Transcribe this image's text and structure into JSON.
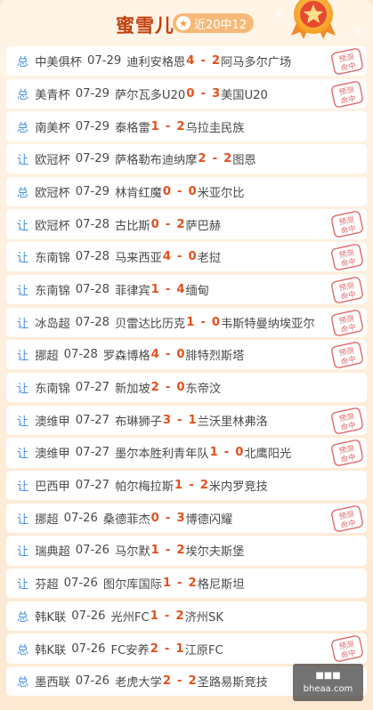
{
  "header": {
    "name": "蜜雪儿",
    "record": "近20中12"
  },
  "stamp_text": "预测命中",
  "rows": [
    {
      "type": "总",
      "league": "中美俱杯",
      "date": "07-29",
      "home": "迪利安格恩",
      "home_score": "4",
      "away_score": "2",
      "away": "阿马多尔广场",
      "hit": true
    },
    {
      "type": "总",
      "league": "美青杯",
      "date": "07-29",
      "home": "萨尔瓦多U20",
      "home_score": "0",
      "away_score": "3",
      "away": "美国U20",
      "hit": true
    },
    {
      "type": "总",
      "league": "南美杯",
      "date": "07-29",
      "home": "泰格雷",
      "home_score": "1",
      "away_score": "2",
      "away": "乌拉圭民族",
      "hit": false
    },
    {
      "type": "让",
      "league": "欧冠杯",
      "date": "07-29",
      "home": "萨格勒布迪纳摩",
      "home_score": "2",
      "away_score": "2",
      "away": "图恩",
      "hit": false
    },
    {
      "type": "总",
      "league": "欧冠杯",
      "date": "07-29",
      "home": "林肯红魔",
      "home_score": "0",
      "away_score": "0",
      "away": "米亚尔比",
      "hit": false
    },
    {
      "type": "让",
      "league": "欧冠杯",
      "date": "07-28",
      "home": "古比斯",
      "home_score": "0",
      "away_score": "2",
      "away": "萨巴赫",
      "hit": true
    },
    {
      "type": "让",
      "league": "东南锦",
      "date": "07-28",
      "home": "马来西亚",
      "home_score": "4",
      "away_score": "0",
      "away": "老挝",
      "hit": true
    },
    {
      "type": "让",
      "league": "东南锦",
      "date": "07-28",
      "home": "菲律宾",
      "home_score": "1",
      "away_score": "4",
      "away": "缅甸",
      "hit": true
    },
    {
      "type": "让",
      "league": "冰岛超",
      "date": "07-28",
      "home": "贝雷达比历克",
      "home_score": "1",
      "away_score": "0",
      "away": "韦斯特曼纳埃亚尔",
      "hit": true
    },
    {
      "type": "让",
      "league": "挪超",
      "date": "07-28",
      "home": "罗森博格",
      "home_score": "4",
      "away_score": "0",
      "away": "腓特烈斯塔",
      "hit": true
    },
    {
      "type": "让",
      "league": "东南锦",
      "date": "07-27",
      "home": "新加坡",
      "home_score": "2",
      "away_score": "0",
      "away": "东帝汶",
      "hit": false
    },
    {
      "type": "让",
      "league": "澳维甲",
      "date": "07-27",
      "home": "布琳狮子",
      "home_score": "3",
      "away_score": "1",
      "away": "兰沃里林弗洛",
      "hit": true
    },
    {
      "type": "让",
      "league": "澳维甲",
      "date": "07-27",
      "home": "墨尔本胜利青年队",
      "home_score": "1",
      "away_score": "0",
      "away": "北鹰阳光",
      "hit": true
    },
    {
      "type": "让",
      "league": "巴西甲",
      "date": "07-27",
      "home": "帕尔梅拉斯",
      "home_score": "1",
      "away_score": "2",
      "away": "米内罗竞技",
      "hit": false
    },
    {
      "type": "让",
      "league": "挪超",
      "date": "07-26",
      "home": "桑德菲杰",
      "home_score": "0",
      "away_score": "3",
      "away": "博德闪耀",
      "hit": true
    },
    {
      "type": "让",
      "league": "瑞典超",
      "date": "07-26",
      "home": "马尔默",
      "home_score": "1",
      "away_score": "2",
      "away": "埃尔夫斯堡",
      "hit": false
    },
    {
      "type": "让",
      "league": "芬超",
      "date": "07-26",
      "home": "图尔库国际",
      "home_score": "1",
      "away_score": "2",
      "away": "格尼斯坦",
      "hit": false
    },
    {
      "type": "总",
      "league": "韩K联",
      "date": "07-26",
      "home": "光州FC",
      "home_score": "1",
      "away_score": "2",
      "away": "济州SK",
      "hit": false
    },
    {
      "type": "总",
      "league": "韩K联",
      "date": "07-26",
      "home": "FC安养",
      "home_score": "2",
      "away_score": "1",
      "away": "江原FC",
      "hit": true
    },
    {
      "type": "总",
      "league": "墨西联",
      "date": "07-26",
      "home": "老虎大学",
      "home_score": "2",
      "away_score": "2",
      "away": "圣路易斯竞技",
      "hit": false
    }
  ],
  "watermark": {
    "line1": "■■■",
    "line2": "bheaa.com"
  },
  "colors": {
    "accent": "#c2410c",
    "score": "#e4501b",
    "type": "#4a90e2",
    "stamp": "#e06a6a"
  }
}
